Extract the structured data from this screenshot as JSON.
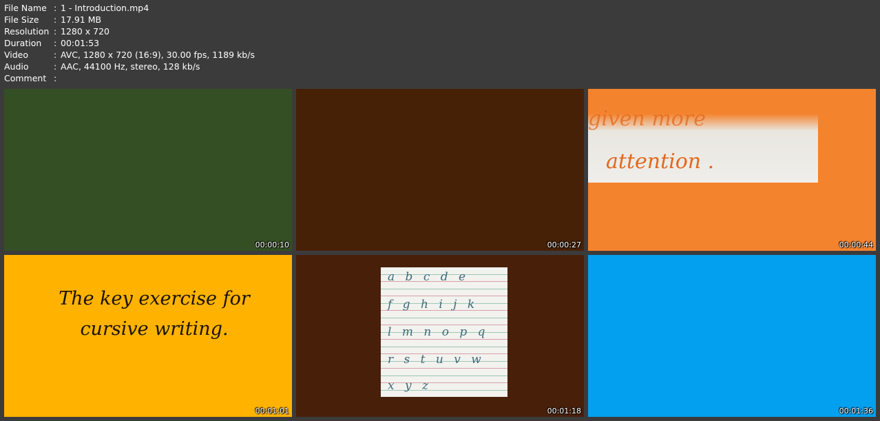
{
  "meta": [
    {
      "label": "File Name",
      "value": "1 - Introduction.mp4"
    },
    {
      "label": "File Size",
      "value": "17.91 MB"
    },
    {
      "label": "Resolution",
      "value": "1280 x 720"
    },
    {
      "label": "Duration",
      "value": "00:01:53"
    },
    {
      "label": "Video",
      "value": "AVC, 1280 x 720 (16:9), 30.00 fps, 1189 kb/s"
    },
    {
      "label": "Audio",
      "value": "AAC, 44100 Hz, stereo, 128 kb/s"
    },
    {
      "label": "Comment",
      "value": ""
    }
  ],
  "separator": ":",
  "thumbnails": [
    {
      "timestamp": "00:00:10",
      "color": "#354f24"
    },
    {
      "timestamp": "00:00:27",
      "color": "#472106"
    },
    {
      "timestamp": "00:00:44",
      "color": "#f4832e",
      "text_top": "given more",
      "text_main": "attention ."
    },
    {
      "timestamp": "00:01:01",
      "color": "#ffb300",
      "text": "The key exercise for cursive writing."
    },
    {
      "timestamp": "00:01:18",
      "color": "#48200a",
      "lines": [
        "a b c d e",
        "f g h i j k",
        "l m n o p q",
        "r s t u v w",
        "x y z"
      ]
    },
    {
      "timestamp": "00:01:36",
      "color": "#03a0ef"
    }
  ]
}
